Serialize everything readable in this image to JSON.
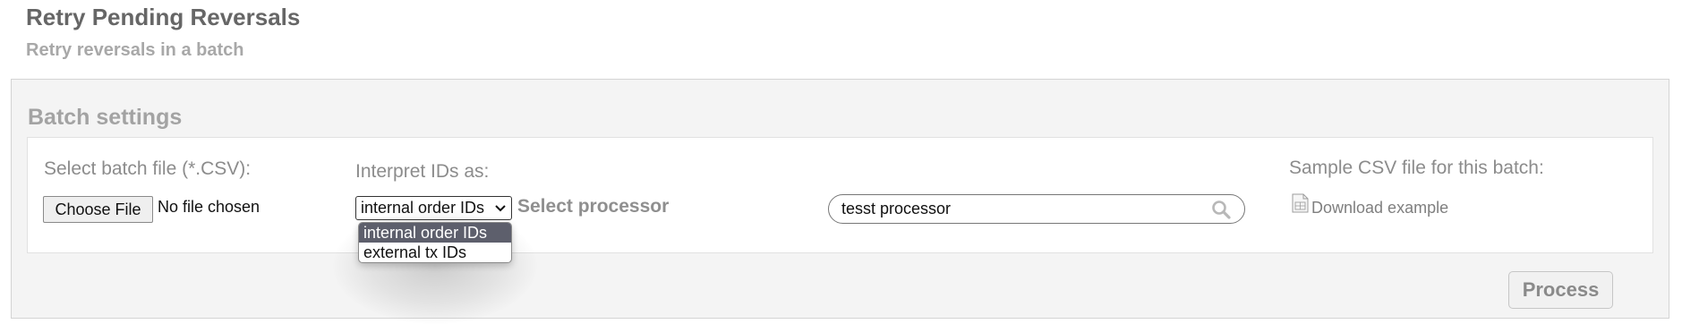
{
  "page": {
    "title": "Retry Pending Reversals",
    "subtitle": "Retry reversals in a batch"
  },
  "batch_settings": {
    "title": "Batch settings",
    "file": {
      "label": "Select batch file (*.CSV):",
      "button_label": "Choose File",
      "status": "No file chosen"
    },
    "interpret": {
      "label": "Interpret IDs as:",
      "selected": "internal order IDs",
      "options": [
        "internal order IDs",
        "external tx IDs"
      ]
    },
    "processor": {
      "label": "Select processor",
      "search_value": "tesst processor",
      "icon": "search-icon"
    },
    "sample": {
      "label": "Sample CSV file for this batch:",
      "link_text": "Download example",
      "icon": "csv-file-icon"
    }
  },
  "actions": {
    "process_label": "Process"
  },
  "colors": {
    "title": "#666666",
    "muted": "#a8a8a8",
    "panel_bg": "#f4f4f4",
    "selected_option_bg": "#5d5f6c"
  }
}
